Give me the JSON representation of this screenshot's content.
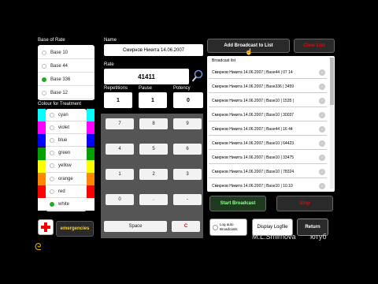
{
  "base_of_rate": {
    "label": "Base of Rate",
    "options": [
      "Base 10",
      "Base 44",
      "Base 336",
      "Base 12"
    ],
    "selected": "Base 336"
  },
  "colour": {
    "label": "Colour for Treatment",
    "options": [
      {
        "name": "cyan",
        "color": "#00ffff"
      },
      {
        "name": "violet",
        "color": "#ff00ff"
      },
      {
        "name": "blue",
        "color": "#0000ff"
      },
      {
        "name": "green",
        "color": "#00a000"
      },
      {
        "name": "yellow",
        "color": "#ffff00"
      },
      {
        "name": "orange",
        "color": "#ff8800"
      },
      {
        "name": "red",
        "color": "#ff0000"
      },
      {
        "name": "white",
        "color": "#ffffff"
      }
    ],
    "selected": "white"
  },
  "emergencies_label": "emergencies",
  "name_label": "Name",
  "name_value": "Смирнов Никита 14.06.2007",
  "rate_label": "Rate",
  "rate_value": "41411",
  "repetitions_label": "Repetitions",
  "repetitions_value": "1",
  "pause_label": "Pause",
  "pause_value": "1",
  "potency_label": "Potency",
  "potency_value": "0",
  "keypad": {
    "keys": [
      "7",
      "8",
      "9",
      "4",
      "5",
      "6",
      "1",
      "2",
      "3",
      "0",
      ".",
      "-"
    ],
    "space": "Space",
    "clear": "C"
  },
  "add_broadcast": "Add Broadcast to List",
  "clear_list": "Clear List",
  "broadcast_list_title": "Broadcast list",
  "broadcast_items": [
    "Смирнов Никита 14.06.2007 | Base44 | 07 14",
    "Смирнов Никита 14.06.2007 | Base336 | 3459",
    "Смирнов Никита 14.06.2007 | Base10 | 1535 |",
    "Смирнов Никита 14.06.2007 | Base10 | 30037",
    "Смирнов Никита 14.06.2007 | Base44 | 16 44",
    "Смирнов Никита 14.06.2007 | Base10 | 64423",
    "Смирнов Никита 14.06.2007 | Base10 | 33475",
    "Смирнов Никита 14.06.2007 | Base10 | 78324",
    "Смирнов Никита 14.06.2007 | Base10 | 10.10"
  ],
  "start_broadcast": "Start Broadcast",
  "stop": "Stop",
  "log_auto_broadcasts": "Log auto Broadcasts",
  "display_logfile": "Display Logfile",
  "return": "Return",
  "watermark": "M.L.Smirnova",
  "channel": "ютуб",
  "colors": {
    "accent_red": "#cc1111",
    "green_button": "#1f7a1f",
    "dark_bg": "#2a2a2a",
    "emergency_yellow": "#f4d03f"
  }
}
